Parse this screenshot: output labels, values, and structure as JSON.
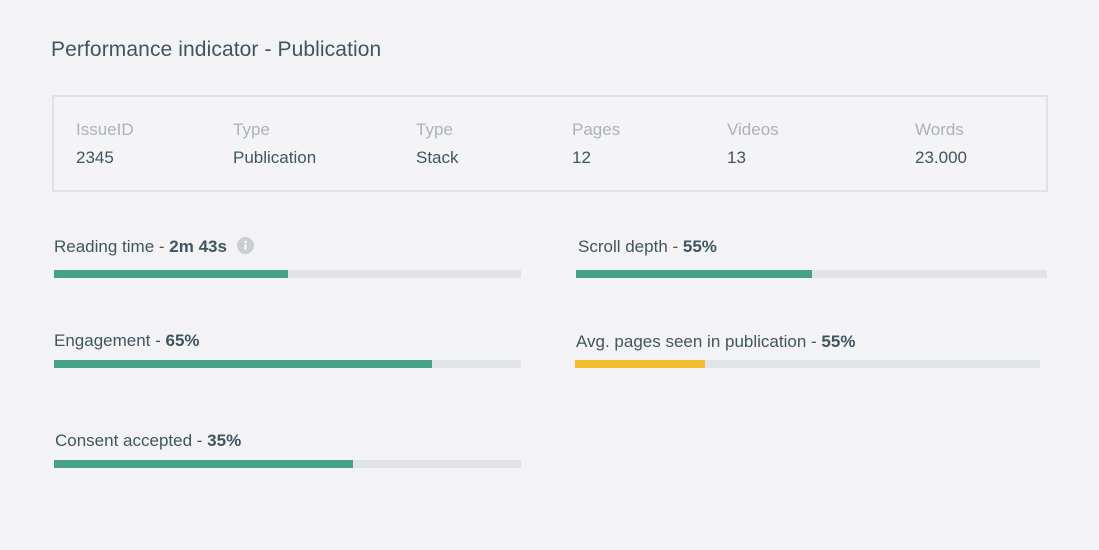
{
  "header": {
    "title": "Performance indicator - Publication"
  },
  "summary": {
    "columns": [
      {
        "label": "IssueID",
        "value": "2345"
      },
      {
        "label": "Type",
        "value": "Publication"
      },
      {
        "label": "Type",
        "value": "Stack"
      },
      {
        "label": "Pages",
        "value": "12"
      },
      {
        "label": "Videos",
        "value": "13"
      },
      {
        "label": "Words",
        "value": "23.000"
      }
    ]
  },
  "metrics": {
    "reading_time": {
      "label": "Reading time - ",
      "value": "2m 43s",
      "fill": 0.5,
      "color": "#45a287",
      "icon": "info-icon"
    },
    "scroll_depth": {
      "label": "Scroll depth - ",
      "value": "55%",
      "fill": 0.5,
      "color": "#45a287"
    },
    "engagement": {
      "label": "Engagement - ",
      "value": "65%",
      "fill": 0.81,
      "color": "#45a287"
    },
    "avg_pages": {
      "label": "Avg. pages seen in publication - ",
      "value": "55%",
      "fill": 0.28,
      "color": "#f3bd2e"
    },
    "consent": {
      "label": "Consent accepted - ",
      "value": "35%",
      "fill": 0.64,
      "color": "#45a287"
    }
  }
}
